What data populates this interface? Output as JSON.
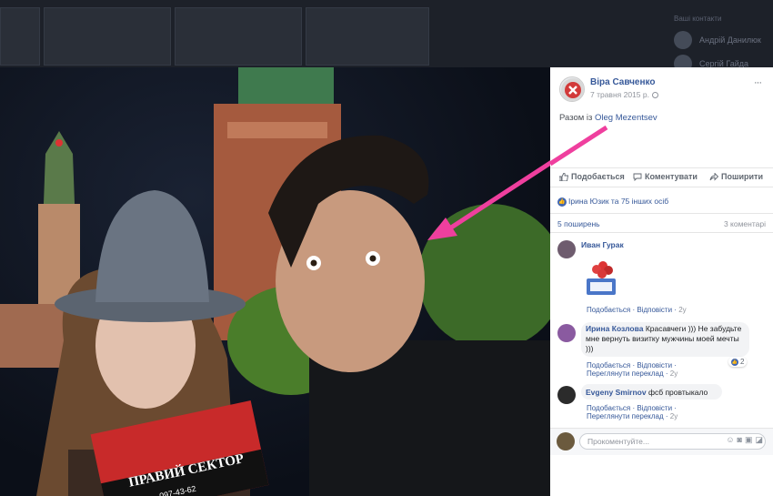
{
  "background": {
    "sidebar_heading": "Ваші контакти",
    "friends": [
      "Андрій Данилюк",
      "Сергій Гайда"
    ]
  },
  "post": {
    "author": "Віра Савченко",
    "date": "7 травня 2015 р.",
    "with_prefix": "Разом із",
    "with_name": "Oleg Mezentsev",
    "more": "···"
  },
  "actions": {
    "like": "Подобається",
    "comment": "Коментувати",
    "share": "Поширити"
  },
  "reactions": {
    "text": "Ірина Юзик та 75 інших осіб"
  },
  "counts": {
    "shares": "5 поширень",
    "comments": "3 коментарі"
  },
  "comments": [
    {
      "name": "Иван Гурак",
      "text": "",
      "like": "Подобається",
      "reply": "Відповісти",
      "time": "2у"
    },
    {
      "name": "Ирина Козлова",
      "text": "Красавчеги ))) Не забудьте мне вернуть визитку мужчины моей мечты )))",
      "like": "Подобається",
      "reply": "Відповісти",
      "translate": "Переглянути переклад",
      "time": "2у",
      "reaction_count": "2"
    },
    {
      "name": "Evgeny Smirnov",
      "text": "фсб провтыкало",
      "like": "Подобається",
      "reply": "Відповісти",
      "translate": "Переглянути переклад",
      "time": "2у"
    }
  ],
  "composer": {
    "placeholder": "Прокоментуйте..."
  },
  "card": {
    "line1": "ПРАВИЙ СЕКТОР",
    "line2": "097-43-62"
  },
  "colors": {
    "link": "#365899",
    "arrow": "#ef3f9e",
    "like_blue": "#4267b2"
  }
}
